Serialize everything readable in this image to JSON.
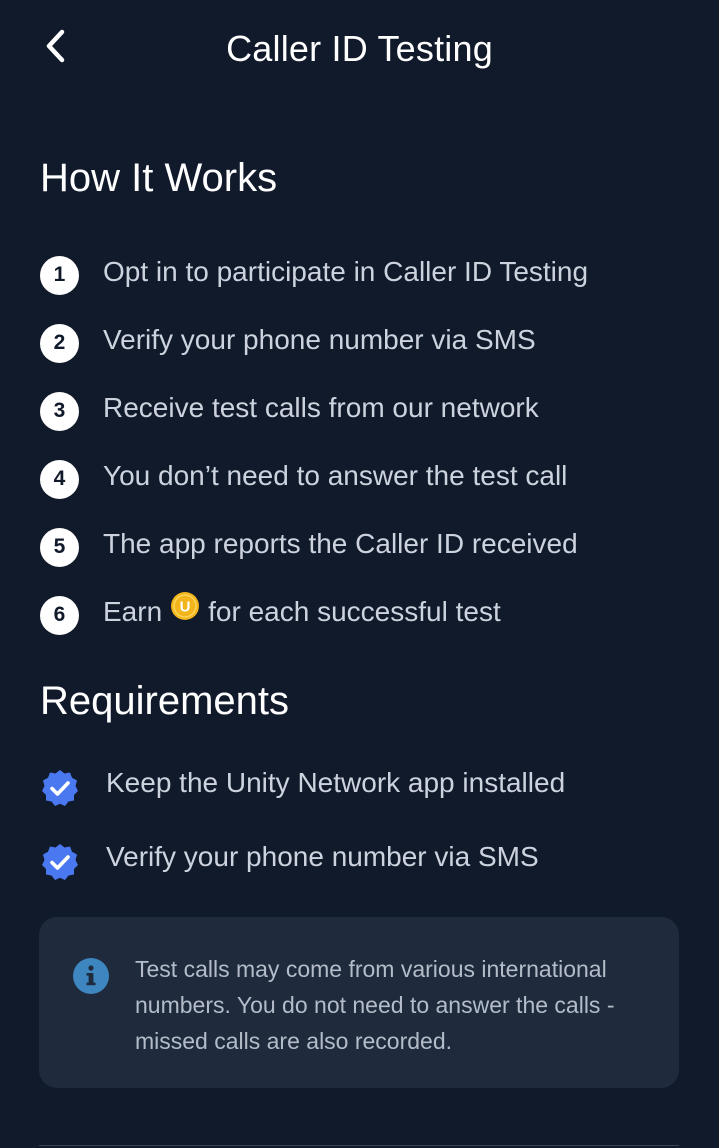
{
  "header": {
    "title": "Caller ID Testing",
    "back_icon": "chevron-left-icon"
  },
  "how_it_works": {
    "heading": "How It Works",
    "steps": [
      {
        "number": "1",
        "text": "Opt in to participate in Caller ID Testing"
      },
      {
        "number": "2",
        "text": "Verify your phone number via SMS"
      },
      {
        "number": "3",
        "text": "Receive test calls from our network"
      },
      {
        "number": "4",
        "text": "You don’t need to answer the test call"
      },
      {
        "number": "5",
        "text": "The app reports the Caller ID received"
      },
      {
        "number": "6",
        "text_before": "Earn",
        "coin_letter": "U",
        "text_after": "for each successful test"
      }
    ]
  },
  "requirements": {
    "heading": "Requirements",
    "items": [
      {
        "text": "Keep the Unity Network app installed",
        "icon": "check-badge-icon"
      },
      {
        "text": "Verify your phone number via SMS",
        "icon": "check-badge-icon"
      }
    ]
  },
  "info_card": {
    "icon": "info-icon",
    "text": "Test calls may come from various international numbers. You do not need to answer the calls - missed calls are also recorded."
  },
  "colors": {
    "background": "#111a2b",
    "card_background": "#1f2a3c",
    "check_blue": "#4a78f0",
    "coin_gold": "#f2b51c",
    "info_blue": "#3d86bf",
    "muted_text": "#cdd3de"
  }
}
